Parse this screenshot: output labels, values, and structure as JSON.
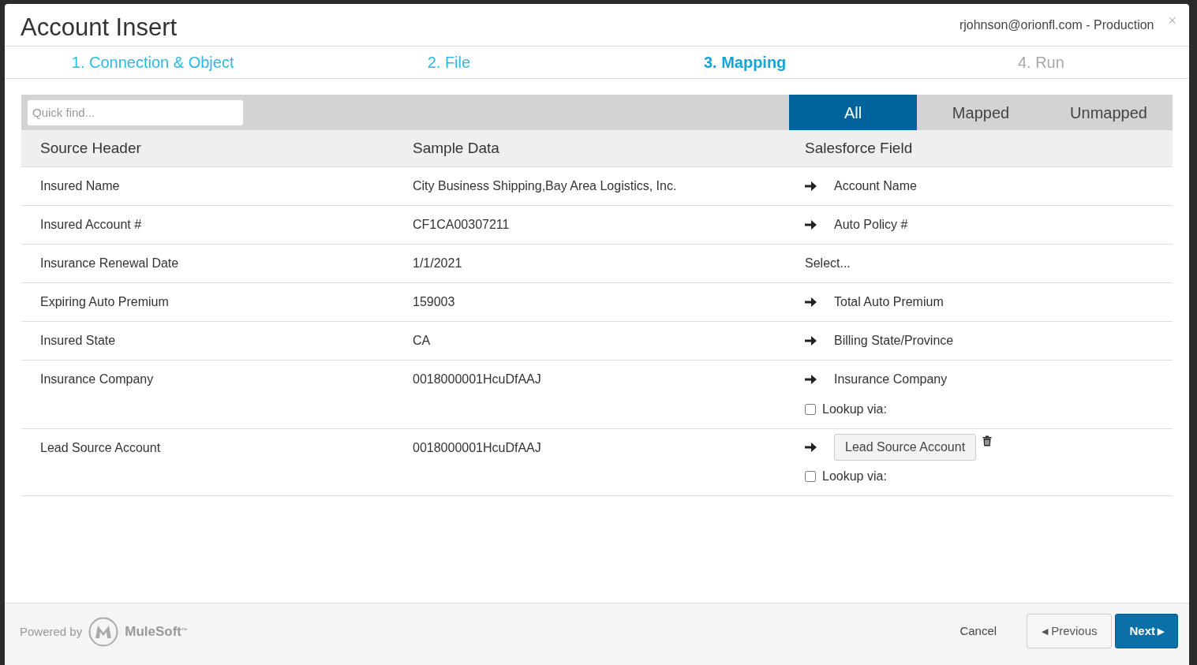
{
  "window": {
    "title": "Account Insert",
    "account": "rjohnson@orionfl.com - Production",
    "close": "×"
  },
  "steps": [
    {
      "label": "1. Connection & Object",
      "selected": false,
      "disabled": false
    },
    {
      "label": "2. File",
      "selected": false,
      "disabled": false
    },
    {
      "label": "3. Mapping",
      "selected": true,
      "disabled": false
    },
    {
      "label": "4. Run",
      "selected": false,
      "disabled": true
    }
  ],
  "search": {
    "placeholder": "Quick find..."
  },
  "filters": [
    {
      "label": "All",
      "selected": true
    },
    {
      "label": "Mapped",
      "selected": false
    },
    {
      "label": "Unmapped",
      "selected": false
    }
  ],
  "table": {
    "columns": [
      "Source Header",
      "Sample Data",
      "Salesforce Field"
    ],
    "rows": [
      {
        "source": "Insured Name",
        "sample": "City Business Shipping,Bay Area Logistics, Inc.",
        "field": {
          "kind": "mapped",
          "label": "Account Name"
        }
      },
      {
        "source": "Insured Account #",
        "sample": "CF1CA00307211",
        "field": {
          "kind": "mapped",
          "label": "Auto Policy #"
        }
      },
      {
        "source": "Insurance Renewal Date",
        "sample": "1/1/2021",
        "field": {
          "kind": "unmapped",
          "label": "Select..."
        }
      },
      {
        "source": "Expiring Auto Premium",
        "sample": "159003",
        "field": {
          "kind": "mapped",
          "label": "Total Auto Premium"
        }
      },
      {
        "source": "Insured State",
        "sample": "CA",
        "field": {
          "kind": "mapped",
          "label": "Billing State/Province"
        }
      },
      {
        "source": "Insurance Company",
        "sample": "0018000001HcuDfAAJ",
        "field": {
          "kind": "mapped",
          "label": "Insurance Company",
          "lookup": {
            "label": "Lookup via:",
            "checked": false
          }
        }
      },
      {
        "source": "Lead Source Account",
        "sample": "0018000001HcuDfAAJ",
        "field": {
          "kind": "button",
          "label": "Lead Source Account",
          "lookup": {
            "label": "Lookup via:",
            "checked": false
          }
        }
      }
    ]
  },
  "footer": {
    "powered_by": "Powered by",
    "brand": "MuleSoft",
    "trademark": "™",
    "buttons": [
      {
        "kind": "link",
        "label": "Cancel"
      },
      {
        "kind": "previous",
        "label": "Previous",
        "icon": "◀"
      },
      {
        "kind": "next",
        "label": "Next",
        "icon": "▶"
      }
    ]
  }
}
